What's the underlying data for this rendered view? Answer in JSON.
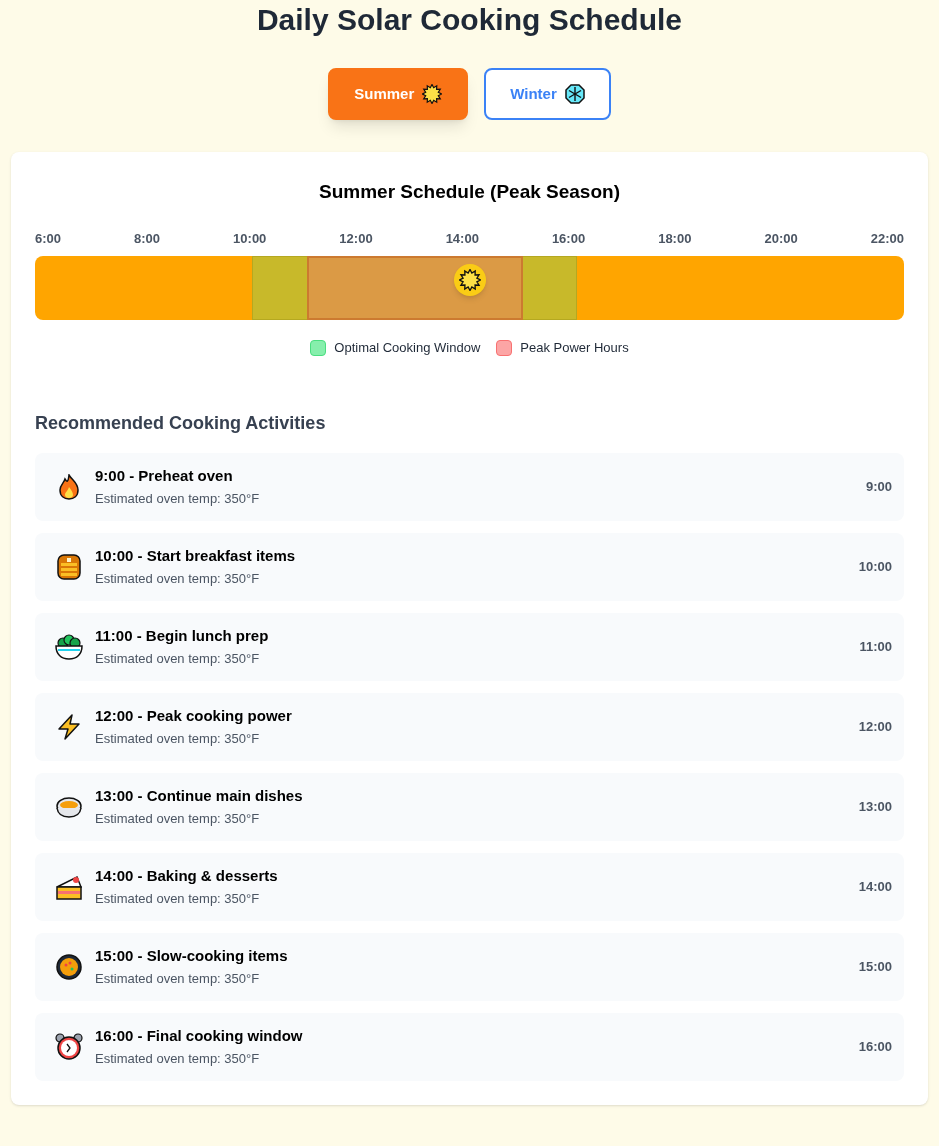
{
  "title": "Daily Solar Cooking Schedule",
  "seasons": [
    {
      "label": "Summer",
      "selected": true
    },
    {
      "label": "Winter",
      "selected": false
    }
  ],
  "schedule": {
    "title": "Summer Schedule (Peak Season)",
    "ticks": [
      "6:00",
      "8:00",
      "10:00",
      "12:00",
      "14:00",
      "16:00",
      "18:00",
      "20:00",
      "22:00"
    ],
    "sun": {
      "level": 0.5
    },
    "legend": [
      "Optimal Cooking Window",
      "Peak Power Hours"
    ]
  },
  "activities": {
    "heading": "Recommended Cooking Activities",
    "items": [
      {
        "title": "9:00 - Preheat oven",
        "detail": "Estimated oven temp: 350°F",
        "time": "9:00"
      },
      {
        "title": "10:00 - Start breakfast items",
        "detail": "Estimated oven temp: 350°F",
        "time": "10:00"
      },
      {
        "title": "11:00 - Begin lunch prep",
        "detail": "Estimated oven temp: 350°F",
        "time": "11:00"
      },
      {
        "title": "12:00 - Peak cooking power",
        "detail": "Estimated oven temp: 350°F",
        "time": "12:00"
      },
      {
        "title": "13:00 - Continue main dishes",
        "detail": "Estimated oven temp: 350°F",
        "time": "13:00"
      },
      {
        "title": "14:00 - Baking & desserts",
        "detail": "Estimated oven temp: 350°F",
        "time": "14:00"
      },
      {
        "title": "15:00 - Slow-cooking items",
        "detail": "Estimated oven temp: 350°F",
        "time": "15:00"
      },
      {
        "title": "16:00 - Final cooking window",
        "detail": "Estimated oven temp: 350°F",
        "time": "16:00"
      }
    ]
  }
}
